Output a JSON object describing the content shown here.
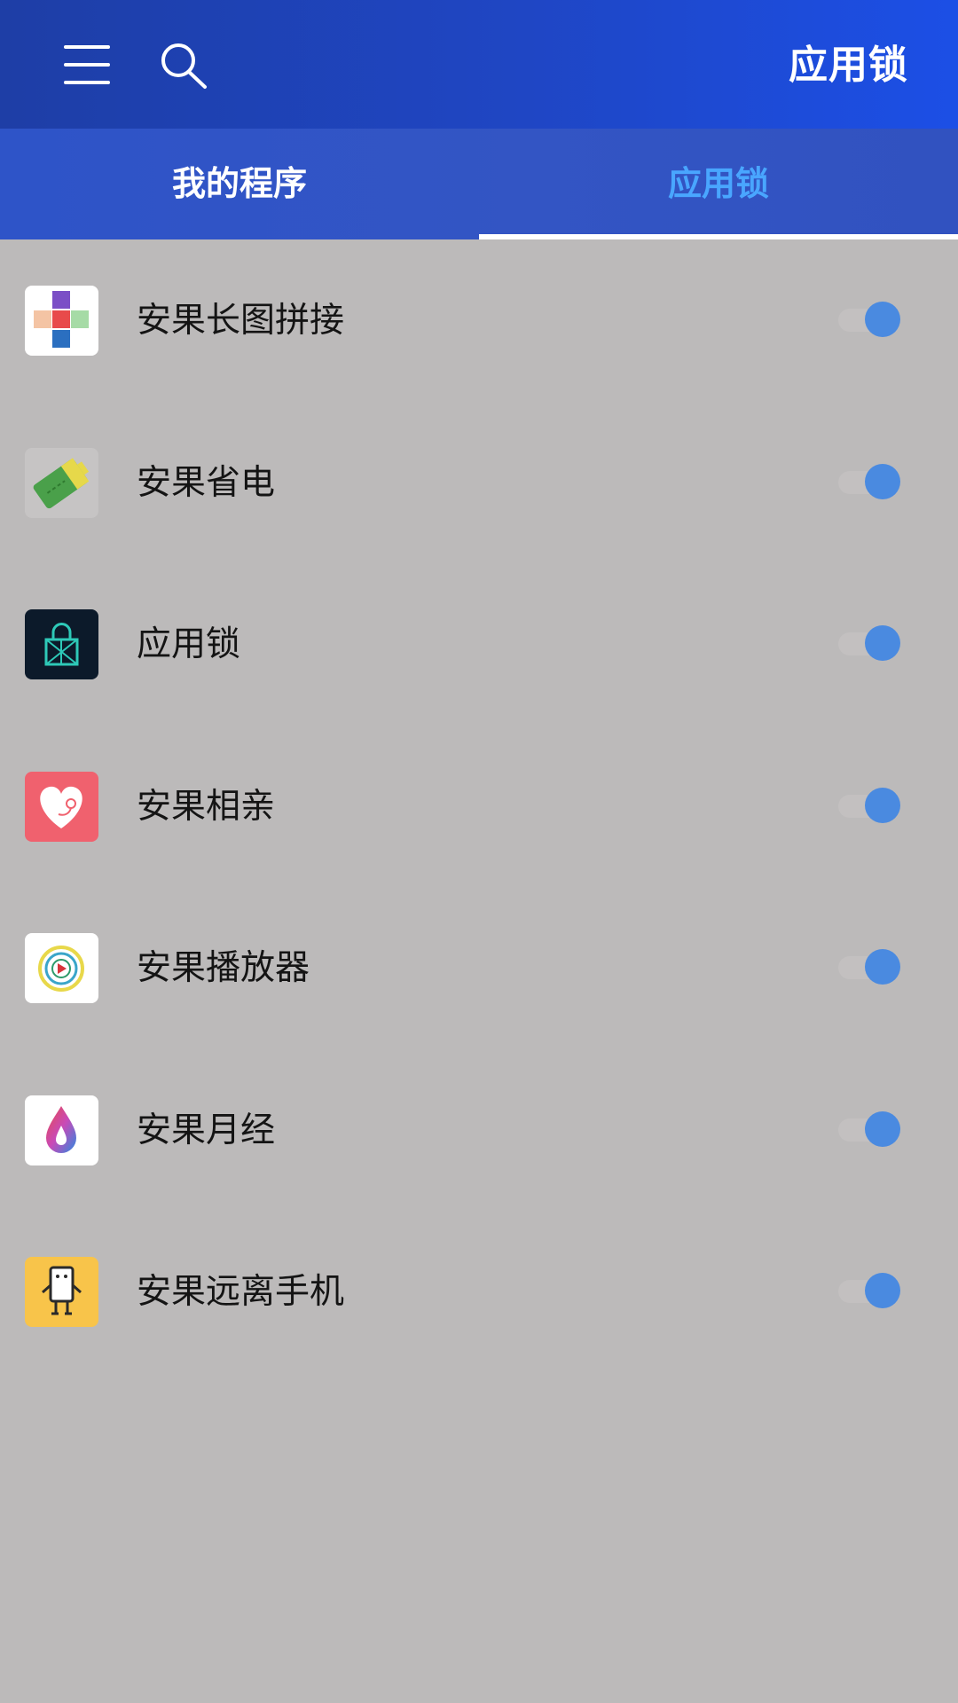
{
  "header": {
    "title": "应用锁",
    "menu_icon": "hamburger-menu-icon",
    "search_icon": "search-icon",
    "background_color": "#1f46c4"
  },
  "tabs": [
    {
      "label": "我的程序",
      "selected": false
    },
    {
      "label": "应用锁",
      "selected": true
    }
  ],
  "colors": {
    "tab_selected_text": "#49a6ff",
    "toggle_knob": "#4a8ae0",
    "list_background": "#bcbaba"
  },
  "apps": [
    {
      "name": "安果长图拼接",
      "icon": "puzzle-cross-icon",
      "locked": true
    },
    {
      "name": "安果省电",
      "icon": "battery-icon",
      "locked": true
    },
    {
      "name": "应用锁",
      "icon": "padlock-pattern-icon",
      "locked": true
    },
    {
      "name": "安果相亲",
      "icon": "heart-icon",
      "locked": true
    },
    {
      "name": "安果播放器",
      "icon": "play-circle-icon",
      "locked": true
    },
    {
      "name": "安果月经",
      "icon": "drop-icon",
      "locked": true
    },
    {
      "name": "安果远离手机",
      "icon": "phone-robot-icon",
      "locked": true
    }
  ]
}
